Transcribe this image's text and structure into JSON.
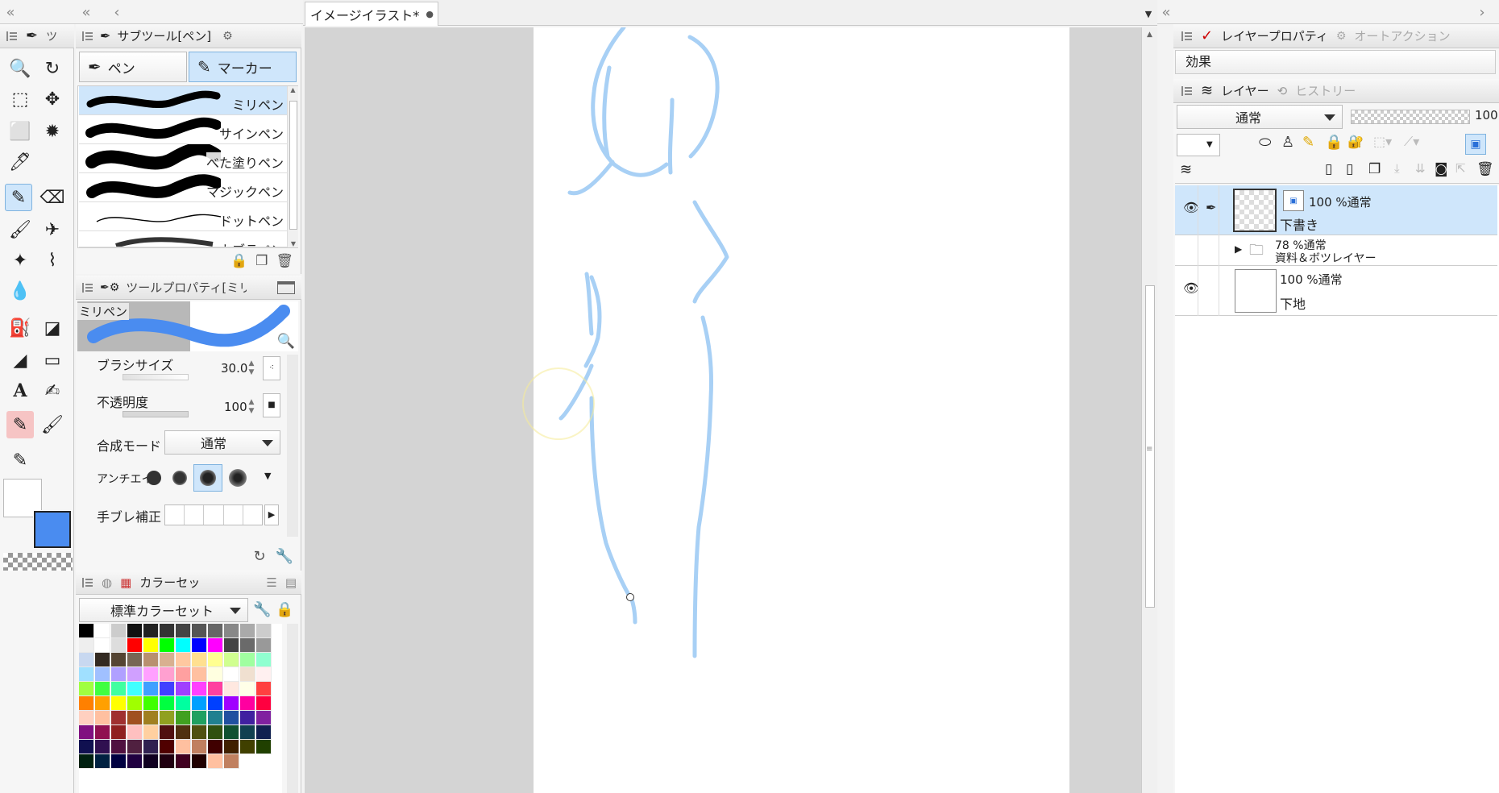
{
  "canvas_tab": {
    "title": "イメージイラスト*",
    "modified_dot": "●"
  },
  "subtool_panel": {
    "title": "サブツール[ペン]",
    "group_buttons": [
      {
        "label": "ペン"
      },
      {
        "label": "マーカー"
      }
    ],
    "brushes": [
      {
        "label": "ミリペン"
      },
      {
        "label": "サインペン"
      },
      {
        "label": "べた塗りペン"
      },
      {
        "label": "マジックペン"
      },
      {
        "label": "ドットペン"
      },
      {
        "label": "カブラペン"
      }
    ]
  },
  "tool_property": {
    "title": "ツールプロパティ[ミリペ",
    "preview_label": "ミリペン",
    "brush_size": {
      "label": "ブラシサイズ",
      "value": "30.0"
    },
    "opacity": {
      "label": "不透明度",
      "value": "100"
    },
    "blend_mode": {
      "label": "合成モード",
      "value": "通常"
    },
    "antialias": {
      "label": "アンチエイ"
    },
    "stabilization": {
      "label": "手ブレ補正"
    }
  },
  "color_set": {
    "title": "カラーセッ",
    "selected_set": "標準カラーセット",
    "rows": [
      [
        "#000000",
        "#ffffff",
        "#cccccc",
        "#111111",
        "#222222",
        "#333333",
        "#444444",
        "#555555",
        "#666666",
        "#888888",
        "#aaaaaa",
        "#cccccc"
      ],
      [
        "#eeeeee",
        "#ffffff",
        "#dddddd",
        "#ff0000",
        "#ffff00",
        "#00ff00",
        "#00ffff",
        "#0000ff",
        "#ff00ff",
        "#444444",
        "#6a6a6a",
        "#999999"
      ],
      [
        "#c8d8f0",
        "#332a22",
        "#554433",
        "#776655",
        "#b89070",
        "#d8b090",
        "#ffc8a0",
        "#ffe090",
        "#ffff90",
        "#d0ff90",
        "#a0ffa0",
        "#90ffd0"
      ],
      [
        "#a0e0ff",
        "#a0c0ff",
        "#b0a0ff",
        "#d0a0ff",
        "#ffa0ff",
        "#ffa0d0",
        "#ffa0a0",
        "#ffc0a0",
        "#ffffe0",
        "#ffffff",
        "#f0e0d0",
        "#fff0f0"
      ],
      [
        "#a0ff40",
        "#40ff40",
        "#40ffa0",
        "#40ffff",
        "#40a0ff",
        "#4040ff",
        "#a040ff",
        "#ff40ff",
        "#ff40a0",
        "#ffe8e0",
        "#ffffe8",
        "#ff4040"
      ],
      [
        "#ff8000",
        "#ffa000",
        "#ffff00",
        "#a0ff00",
        "#40ff00",
        "#00ff40",
        "#00ffa0",
        "#00a0ff",
        "#0040ff",
        "#a000ff",
        "#ff00a0",
        "#ff0040"
      ],
      [
        "#ffd0c0",
        "#ffc0a0",
        "#a03030",
        "#a05020",
        "#a08020",
        "#90a020",
        "#40a020",
        "#20a060",
        "#208090",
        "#2050a0",
        "#4020a0",
        "#8020a0"
      ],
      [
        "#801080",
        "#901050",
        "#902020",
        "#ffc0c0",
        "#ffd0a0",
        "#501010",
        "#503010",
        "#505010",
        "#305010",
        "#105030",
        "#104050",
        "#102050"
      ],
      [
        "#101050",
        "#301050",
        "#501040",
        "#502040",
        "#302050",
        "#500000",
        "#ffc0a0",
        "#c08060",
        "#400000",
        "#402000",
        "#404000",
        "#204000"
      ],
      [
        "#002010",
        "#002040",
        "#000040",
        "#200040",
        "#100020",
        "#200010",
        "#400020",
        "#200000",
        "#ffc0a0",
        "#c08060"
      ]
    ]
  },
  "layer_property": {
    "title": "レイヤープロパティ",
    "auto_action_tab": "オートアクション",
    "effect_label": "効果"
  },
  "layer_panel": {
    "title": "レイヤー",
    "history_tab": "ヒストリー",
    "blend_mode": "通常",
    "opacity_value": "100",
    "layers": [
      {
        "info": "100 %通常",
        "name": "下書き"
      },
      {
        "info": "78 %通常",
        "name": "資料＆ボツレイヤー"
      },
      {
        "info": "100 %通常",
        "name": "下地"
      }
    ]
  },
  "colors": {
    "main": "#4a8cf0",
    "sub": "#ffffff",
    "stroke": "#a8d0f5",
    "selection": "#cfe6fb"
  }
}
